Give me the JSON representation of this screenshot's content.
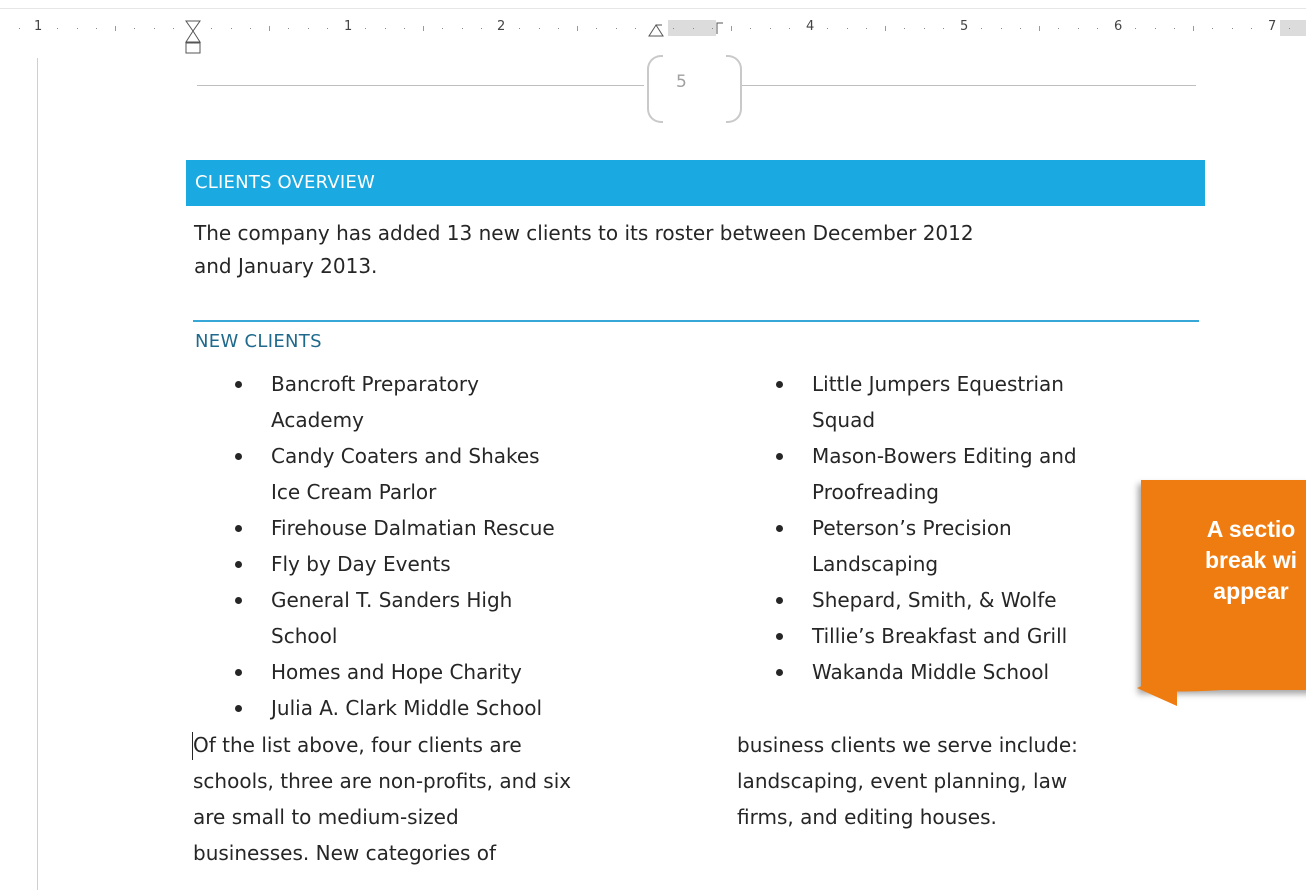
{
  "ruler": {
    "labels": [
      "1",
      "1",
      "2",
      "4",
      "5",
      "6",
      "7"
    ]
  },
  "header": {
    "page_number": "5"
  },
  "document": {
    "heading": "CLIENTS OVERVIEW",
    "intro_line1": "The company has added 13 new clients to its roster between December 2012",
    "intro_line2": "and January 2013.",
    "subheading": "NEW CLIENTS",
    "clients_col1": [
      [
        "Bancroft Preparatory",
        "Academy"
      ],
      [
        "Candy Coaters and Shakes",
        "Ice Cream Parlor"
      ],
      [
        "Firehouse Dalmatian Rescue"
      ],
      [
        "Fly by Day Events"
      ],
      [
        "General T. Sanders High",
        "School"
      ],
      [
        "Homes and Hope Charity"
      ],
      [
        "Julia A. Clark Middle School"
      ]
    ],
    "clients_col2": [
      [
        "Little Jumpers Equestrian",
        "Squad"
      ],
      [
        "Mason-Bowers Editing and",
        "Proofreading"
      ],
      [
        "Peterson’s Precision",
        "Landscaping"
      ],
      [
        "Shepard, Smith, & Wolfe"
      ],
      [
        "Tillie’s Breakfast and Grill"
      ],
      [
        "Wakanda Middle School"
      ]
    ],
    "body_col1": [
      "Of the list above, four clients are",
      "schools, three are non-profits, and six",
      "are small to medium-sized",
      "businesses. New categories of"
    ],
    "body_col2": [
      "business clients we serve include:",
      "landscaping, event planning, law",
      "firms, and editing houses."
    ]
  },
  "callout": {
    "lines": [
      "A sectio",
      "break wi",
      "appear"
    ],
    "color": "#ef7c11"
  },
  "colors": {
    "heading_bar": "#1aa9e0",
    "subheading": "#1f6a8c",
    "rule": "#37a7d8"
  }
}
